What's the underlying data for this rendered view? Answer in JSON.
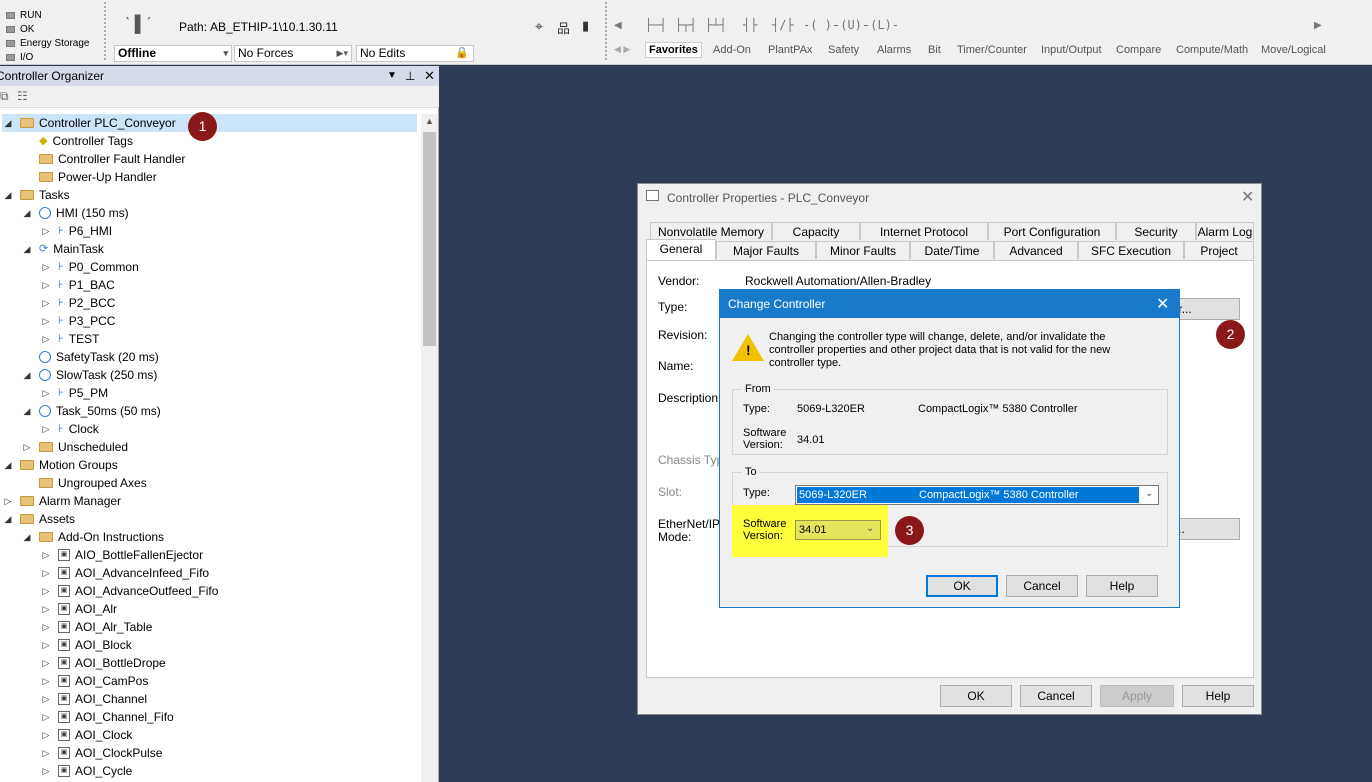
{
  "toolbar": {
    "status": [
      "RUN",
      "OK",
      "Energy Storage",
      "I/O"
    ],
    "path_label": "Path:",
    "path_value": "AB_ETHIP-1\\10.1.30.11",
    "mode": "Offline",
    "forces": "No Forces",
    "edits": "No Edits",
    "categories": [
      "Favorites",
      "Add-On",
      "PlantPAx",
      "Safety",
      "Alarms",
      "Bit",
      "Timer/Counter",
      "Input/Output",
      "Compare",
      "Compute/Math",
      "Move/Logical"
    ]
  },
  "organizer": {
    "title": "Controller Organizer",
    "tree": [
      {
        "label": "Controller PLC_Conveyor",
        "icon": "folder-open-icon",
        "twisty": "open"
      },
      {
        "label": "Controller Tags",
        "icon": "tag-icon",
        "twisty": ""
      },
      {
        "label": "Controller Fault Handler",
        "icon": "folder-icon",
        "twisty": ""
      },
      {
        "label": "Power-Up Handler",
        "icon": "folder-icon",
        "twisty": ""
      },
      {
        "label": "Tasks",
        "icon": "folder-open-icon",
        "twisty": "open"
      },
      {
        "label": "HMI (150 ms)",
        "icon": "clock-icon",
        "twisty": "open"
      },
      {
        "label": "P6_HMI",
        "icon": "program-icon",
        "twisty": "closed"
      },
      {
        "label": "MainTask",
        "icon": "continuous-task-icon",
        "twisty": "open"
      },
      {
        "label": "P0_Common",
        "icon": "program-icon",
        "twisty": "closed"
      },
      {
        "label": "P1_BAC",
        "icon": "program-icon",
        "twisty": "closed"
      },
      {
        "label": "P2_BCC",
        "icon": "program-icon",
        "twisty": "closed"
      },
      {
        "label": "P3_PCC",
        "icon": "program-icon",
        "twisty": "closed"
      },
      {
        "label": "TEST",
        "icon": "program-icon",
        "twisty": "closed"
      },
      {
        "label": "SafetyTask (20 ms)",
        "icon": "clock-icon",
        "twisty": ""
      },
      {
        "label": "SlowTask (250 ms)",
        "icon": "clock-icon",
        "twisty": "open"
      },
      {
        "label": "P5_PM",
        "icon": "program-icon",
        "twisty": "closed"
      },
      {
        "label": "Task_50ms (50 ms)",
        "icon": "clock-icon",
        "twisty": "open"
      },
      {
        "label": "Clock",
        "icon": "program-icon",
        "twisty": "closed"
      },
      {
        "label": "Unscheduled",
        "icon": "folder-icon",
        "twisty": "closed"
      },
      {
        "label": "Motion Groups",
        "icon": "folder-open-icon",
        "twisty": "open"
      },
      {
        "label": "Ungrouped Axes",
        "icon": "folder-icon",
        "twisty": ""
      },
      {
        "label": "Alarm Manager",
        "icon": "folder-icon",
        "twisty": "closed"
      },
      {
        "label": "Assets",
        "icon": "folder-open-icon",
        "twisty": "open"
      },
      {
        "label": "Add-On Instructions",
        "icon": "folder-open-icon",
        "twisty": "open"
      },
      {
        "label": "AIO_BottleFallenEjector",
        "icon": "aoi-icon",
        "twisty": "closed"
      },
      {
        "label": "AOI_AdvanceInfeed_Fifo",
        "icon": "aoi-icon",
        "twisty": "closed"
      },
      {
        "label": "AOI_AdvanceOutfeed_Fifo",
        "icon": "aoi-icon",
        "twisty": "closed"
      },
      {
        "label": "AOI_Alr",
        "icon": "aoi-icon",
        "twisty": "closed"
      },
      {
        "label": "AOI_Alr_Table",
        "icon": "aoi-icon",
        "twisty": "closed"
      },
      {
        "label": "AOI_Block",
        "icon": "aoi-icon",
        "twisty": "closed"
      },
      {
        "label": "AOI_BottleDrope",
        "icon": "aoi-icon",
        "twisty": "closed"
      },
      {
        "label": "AOI_CamPos",
        "icon": "aoi-icon",
        "twisty": "closed"
      },
      {
        "label": "AOI_Channel",
        "icon": "aoi-icon",
        "twisty": "closed"
      },
      {
        "label": "AOI_Channel_Fifo",
        "icon": "aoi-icon",
        "twisty": "closed"
      },
      {
        "label": "AOI_Clock",
        "icon": "aoi-icon",
        "twisty": "closed"
      },
      {
        "label": "AOI_ClockPulse",
        "icon": "aoi-icon",
        "twisty": "closed"
      },
      {
        "label": "AOI_Cycle",
        "icon": "aoi-icon",
        "twisty": "closed"
      }
    ]
  },
  "props": {
    "title": "Controller Properties - PLC_Conveyor",
    "tabs_row1": [
      "Nonvolatile Memory",
      "Capacity",
      "Internet Protocol",
      "Port Configuration",
      "Security",
      "Alarm Log"
    ],
    "tabs_row2": [
      "General",
      "Major Faults",
      "Minor Faults",
      "Date/Time",
      "Advanced",
      "SFC Execution",
      "Project"
    ],
    "vendor_label": "Vendor:",
    "vendor_value": "Rockwell Automation/Allen-Bradley",
    "type_label": "Type:",
    "revision_label": "Revision:",
    "name_label": "Name:",
    "description_label": "Description:",
    "chassis_label": "Chassis Type:",
    "slot_label": "Slot:",
    "ethernet_label": "EtherNet/IP Mode:",
    "change_controller_btn": "Change Controller...",
    "ip_mode_btn": "Change IP Mode...",
    "ok": "OK",
    "cancel": "Cancel",
    "apply": "Apply",
    "help": "Help"
  },
  "change": {
    "title": "Change Controller",
    "warning": "Changing the controller type will change, delete, and/or invalidate the controller properties and other project data that is not valid for the new controller type.",
    "from_label": "From",
    "from_type_label": "Type:",
    "from_type": "5069-L320ER",
    "from_desc": "CompactLogix™ 5380 Controller",
    "from_sw_label": "Software Version:",
    "from_sw": "34.01",
    "to_label": "To",
    "to_type_label": "Type:",
    "to_type": "5069-L320ER",
    "to_desc": "CompactLogix™ 5380 Controller",
    "to_sw_label": "Software Version:",
    "to_sw": "34.01",
    "ok": "OK",
    "cancel": "Cancel",
    "help": "Help"
  },
  "markers": [
    "1",
    "2",
    "3"
  ],
  "colors": {
    "accent": "#1979ca",
    "marker": "#8b1818",
    "highlight": "#ffff3c",
    "background": "#2e3c56"
  }
}
